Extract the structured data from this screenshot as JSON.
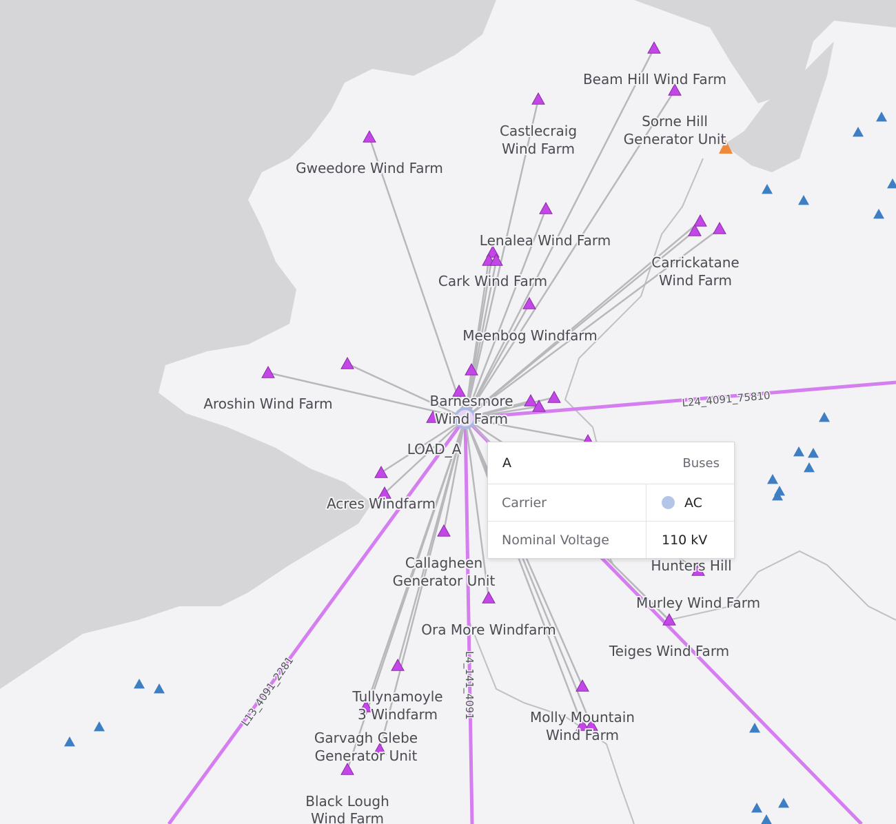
{
  "map": {
    "colors": {
      "sea": "#d6d6d9",
      "land": "#f3f3f5",
      "border": "#bfbfc4",
      "line": "#d47ef0",
      "link": "#b8b8bc",
      "generator": "#c247e6",
      "other_bus": "#3d7fc2",
      "highlight": "#f0883a"
    },
    "labels": [
      {
        "text": "Beam Hill Wind Farm"
      },
      {
        "text": "Castlecraig"
      },
      {
        "text": "Wind Farm"
      },
      {
        "text": "Sorne Hill"
      },
      {
        "text": "Generator Unit"
      },
      {
        "text": "Gweedore Wind Farm"
      },
      {
        "text": "Lenalea Wind Farm"
      },
      {
        "text": "Cark Wind Farm"
      },
      {
        "text": "Carrickatane"
      },
      {
        "text": "Wind Farm"
      },
      {
        "text": "Meenbog Windfarm"
      },
      {
        "text": "Barnesmore"
      },
      {
        "text": "Wind Farm"
      },
      {
        "text": "Aroshin Wind Farm"
      },
      {
        "text": "LOAD_A"
      },
      {
        "text": "Acres Windfarm"
      },
      {
        "text": "Callagheen"
      },
      {
        "text": "Generator Unit"
      },
      {
        "text": "Hunters Hill"
      },
      {
        "text": "Murley Wind Farm"
      },
      {
        "text": "Ora More Windfarm"
      },
      {
        "text": "Teiges Wind Farm"
      },
      {
        "text": "Tullynamoyle"
      },
      {
        "text": "3 Windfarm"
      },
      {
        "text": "Molly Mountain"
      },
      {
        "text": "Wind Farm"
      },
      {
        "text": "Garvagh Glebe"
      },
      {
        "text": "Generator Unit"
      },
      {
        "text": "Black Lough"
      },
      {
        "text": "Wind Farm"
      }
    ],
    "line_labels": [
      "L24_4091_75810",
      "L13_4091_2281",
      "L4_141_4091"
    ]
  },
  "tooltip": {
    "title": "A",
    "type": "Buses",
    "rows": [
      {
        "key": "Carrier",
        "value": "AC",
        "dot_color": "#b4c6e7"
      },
      {
        "key": "Nominal Voltage",
        "value": "110 kV"
      }
    ]
  }
}
